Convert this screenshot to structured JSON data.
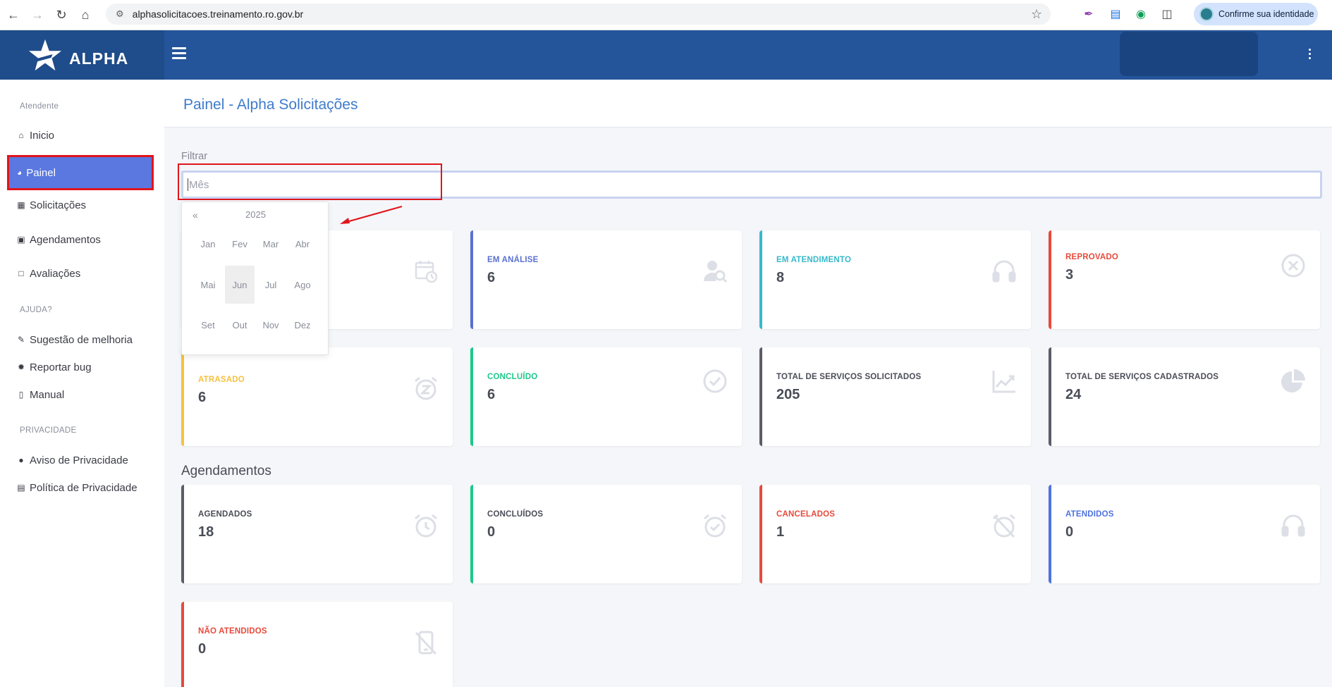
{
  "browser": {
    "url": "alphasolicitacoes.treinamento.ro.gov.br",
    "profile_label": "Confirme sua identidade"
  },
  "app": {
    "brand": "ALPHA"
  },
  "sidebar": {
    "section_atendente": "Atendente",
    "items_main": [
      {
        "label": "Inicio",
        "icon": "home-icon"
      },
      {
        "label": "Painel",
        "icon": "dashboard-icon"
      },
      {
        "label": "Solicitações",
        "icon": "clipboard-icon"
      },
      {
        "label": "Agendamentos",
        "icon": "calendar-icon"
      },
      {
        "label": "Avaliações",
        "icon": "comment-icon"
      }
    ],
    "section_ajuda": "AJUDA?",
    "items_help": [
      {
        "label": "Sugestão de melhoria",
        "icon": "edit-icon"
      },
      {
        "label": "Reportar bug",
        "icon": "bug-icon"
      },
      {
        "label": "Manual",
        "icon": "book-icon"
      }
    ],
    "section_privacidade": "PRIVACIDADE",
    "items_privacy": [
      {
        "label": "Aviso de Privacidade",
        "icon": "alert-circle-icon"
      },
      {
        "label": "Política de Privacidade",
        "icon": "document-icon"
      }
    ]
  },
  "page": {
    "title": "Painel - Alpha Solicitações",
    "filter_label": "Filtrar",
    "filter_placeholder": "Mês"
  },
  "picker": {
    "prev": "«",
    "year": "2025",
    "months": [
      "Jan",
      "Fev",
      "Mar",
      "Abr",
      "Mai",
      "Jun",
      "Jul",
      "Ago",
      "Set",
      "Out",
      "Nov",
      "Dez"
    ],
    "selected": "Jun"
  },
  "solicitacoes_cards": [
    {
      "label": "EM ANÁLISE",
      "value": "6",
      "color": "#5a6fd0",
      "icon": "user-search-icon"
    },
    {
      "label": "EM ATENDIMENTO",
      "value": "8",
      "color": "#36b9cc",
      "icon": "headset-icon"
    },
    {
      "label": "REPROVADO",
      "value": "3",
      "color": "#e74a3b",
      "icon": "x-circle-icon"
    },
    {
      "label": "ATRASADO",
      "value": "6",
      "color": "#f6c23e",
      "icon": "alarm-snooze-icon"
    },
    {
      "label": "CONCLUÍDO",
      "value": "6",
      "color": "#1cc88a",
      "icon": "check-circle-icon"
    },
    {
      "label": "TOTAL DE SERVIÇOS SOLICITADOS",
      "value": "205",
      "color": "#5a5c69",
      "icon": "chart-line-icon"
    },
    {
      "label": "TOTAL DE SERVIÇOS CADASTRADOS",
      "value": "24",
      "color": "#5a5c69",
      "icon": "pie-chart-icon"
    }
  ],
  "agendamentos": {
    "title": "Agendamentos",
    "cards": [
      {
        "label": "AGENDADOS",
        "value": "18",
        "color": "#5a5c69",
        "icon": "alarm-clock-icon"
      },
      {
        "label": "CONCLUÍDOS",
        "value": "0",
        "color": "#1cc88a",
        "icon": "alarm-check-icon"
      },
      {
        "label": "CANCELADOS",
        "value": "1",
        "color": "#e74a3b",
        "icon": "alarm-off-icon"
      },
      {
        "label": "ATENDIDOS",
        "value": "0",
        "color": "#4e73df",
        "icon": "headset-icon"
      },
      {
        "label": "NÃO ATENDIDOS",
        "value": "0",
        "color": "#e74a3b",
        "icon": "phone-off-icon"
      }
    ]
  },
  "colors": {
    "header": "#24559a",
    "brand_bg": "#1f4c8a",
    "active_item": "#5a78e0",
    "annotation_red": "#e0151c"
  }
}
